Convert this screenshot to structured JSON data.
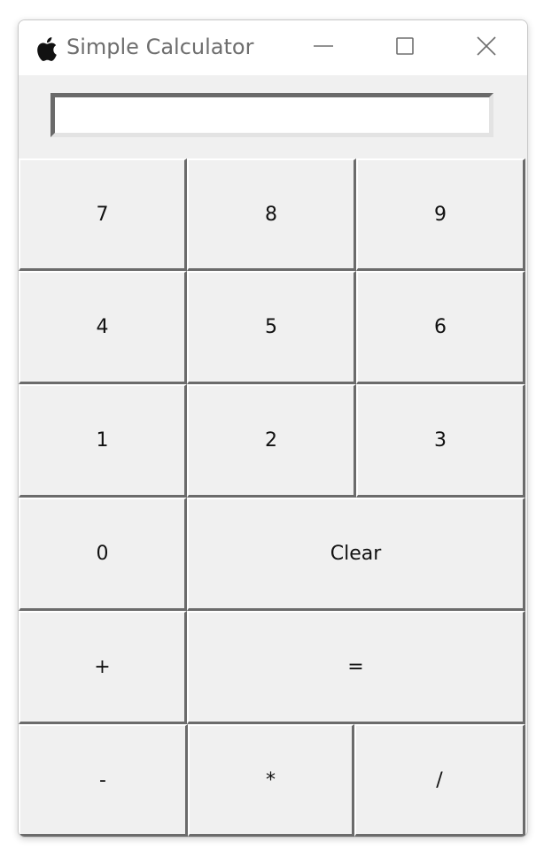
{
  "window": {
    "title": "Simple Calculator",
    "icon": "apple-icon",
    "controls": [
      "minimize-icon",
      "maximize-icon",
      "close-icon"
    ]
  },
  "display": {
    "value": ""
  },
  "keys": {
    "k7": "7",
    "k8": "8",
    "k9": "9",
    "k4": "4",
    "k5": "5",
    "k6": "6",
    "k1": "1",
    "k2": "2",
    "k3": "3",
    "k0": "0",
    "clear": "Clear",
    "plus": "+",
    "equals": "=",
    "minus": "-",
    "multiply": "*",
    "divide": "/"
  },
  "colors": {
    "window_bg": "#f0f0f0",
    "titlebar_bg": "#ffffff",
    "title_text": "#6e6e6e",
    "button_face": "#f0f0f0",
    "button_shadow": "#6b6b6b"
  }
}
